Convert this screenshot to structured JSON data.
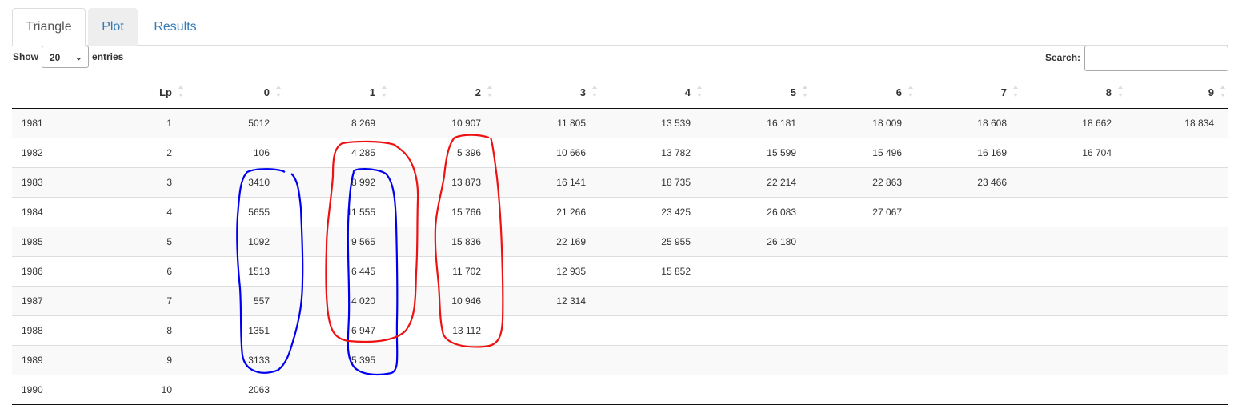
{
  "tabs": [
    {
      "label": "Triangle",
      "state": "active"
    },
    {
      "label": "Plot",
      "state": "hover"
    },
    {
      "label": "Results",
      "state": "link"
    }
  ],
  "length": {
    "show_label": "Show",
    "selected": "20",
    "entries_label": "entries"
  },
  "search": {
    "label": "Search:",
    "value": ""
  },
  "table": {
    "columns": [
      "",
      "Lp",
      "0",
      "1",
      "2",
      "3",
      "4",
      "5",
      "6",
      "7",
      "8",
      "9"
    ],
    "rows": [
      [
        "1981",
        "1",
        "5012",
        "8 269",
        "10 907",
        "11 805",
        "13 539",
        "16 181",
        "18 009",
        "18 608",
        "18 662",
        "18 834"
      ],
      [
        "1982",
        "2",
        "106",
        "4 285",
        "5 396",
        "10 666",
        "13 782",
        "15 599",
        "15 496",
        "16 169",
        "16 704",
        ""
      ],
      [
        "1983",
        "3",
        "3410",
        "8 992",
        "13 873",
        "16 141",
        "18 735",
        "22 214",
        "22 863",
        "23 466",
        "",
        ""
      ],
      [
        "1984",
        "4",
        "5655",
        "11 555",
        "15 766",
        "21 266",
        "23 425",
        "26 083",
        "27 067",
        "",
        "",
        ""
      ],
      [
        "1985",
        "5",
        "1092",
        "9 565",
        "15 836",
        "22 169",
        "25 955",
        "26 180",
        "",
        "",
        "",
        ""
      ],
      [
        "1986",
        "6",
        "1513",
        "6 445",
        "11 702",
        "12 935",
        "15 852",
        "",
        "",
        "",
        "",
        ""
      ],
      [
        "1987",
        "7",
        "557",
        "4 020",
        "10 946",
        "12 314",
        "",
        "",
        "",
        "",
        "",
        ""
      ],
      [
        "1988",
        "8",
        "1351",
        "6 947",
        "13 112",
        "",
        "",
        "",
        "",
        "",
        "",
        ""
      ],
      [
        "1989",
        "9",
        "3133",
        "5 395",
        "",
        "",
        "",
        "",
        "",
        "",
        "",
        ""
      ],
      [
        "1990",
        "10",
        "2063",
        "",
        "",
        "",
        "",
        "",
        "",
        "",
        "",
        ""
      ]
    ]
  },
  "annotations": {
    "blue_color": "#0000ee",
    "red_color": "#ee1111"
  }
}
